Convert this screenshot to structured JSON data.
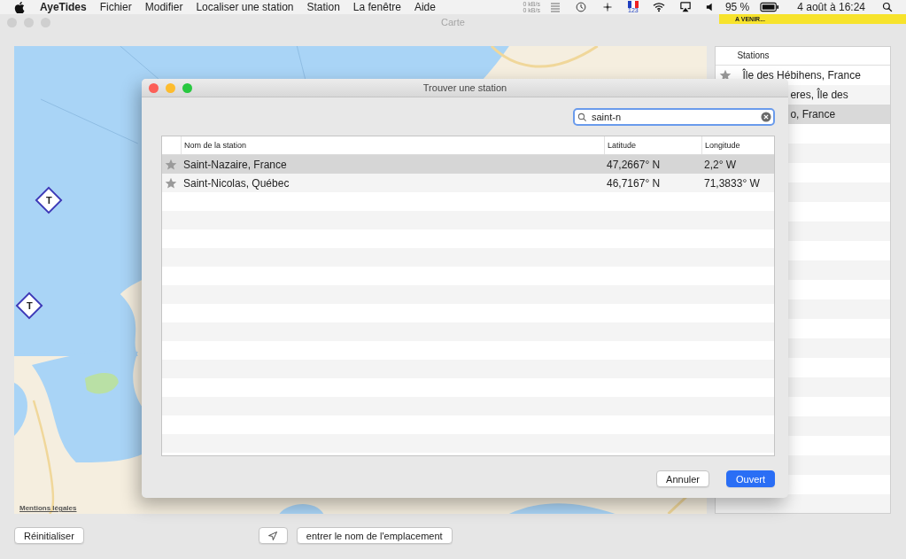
{
  "menubar": {
    "app": "AyeTides",
    "menus": [
      "Fichier",
      "Modifier",
      "Localiser une station",
      "Station",
      "La fenêtre",
      "Aide"
    ],
    "net_up": "0 kB/s",
    "net_down": "0 kB/s",
    "flag_label": "123",
    "battery": "95 %",
    "clock": "4 août à 16:24"
  },
  "notification": {
    "text": "A VENIR..."
  },
  "window": {
    "title": "Carte"
  },
  "map": {
    "markers": [
      {
        "label": "T"
      },
      {
        "label": "T"
      }
    ],
    "legal_link": "Mentions légales"
  },
  "stations": {
    "header": "Stations",
    "rows": [
      {
        "name": "Île des Hébihens, France",
        "starred": true,
        "selected": false
      },
      {
        "name": "eres, Île des",
        "starred": false,
        "selected": false
      },
      {
        "name": "o, France",
        "starred": false,
        "selected": true
      }
    ]
  },
  "bottom": {
    "reset": "Réinitialiser",
    "place_name": "entrer le nom de l'emplacement"
  },
  "dialog": {
    "title": "Trouver une station",
    "search": {
      "value": "saint-n"
    },
    "columns": [
      "Nom de la station",
      "Latitude",
      "Longitude"
    ],
    "rows": [
      {
        "name": "Saint-Nazaire, France",
        "latitude": "47,2667° N",
        "longitude": "2,2° W",
        "starred": true,
        "selected": true
      },
      {
        "name": "Saint-Nicolas, Québec",
        "latitude": "46,7167° N",
        "longitude": "71,3833° W",
        "starred": true,
        "selected": false
      }
    ],
    "buttons": [
      {
        "label": "Annuler",
        "kind": "cancel"
      },
      {
        "label": "Ouvert",
        "kind": "default"
      }
    ]
  }
}
